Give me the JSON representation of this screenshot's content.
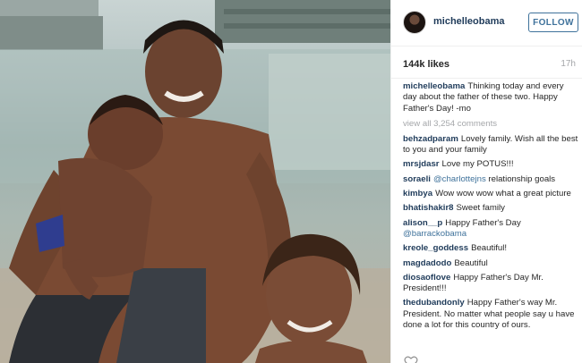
{
  "post": {
    "username": "michelleobama",
    "follow_label": "FOLLOW",
    "likes": "144k likes",
    "time": "17h",
    "caption": {
      "user": "michelleobama",
      "text": "Thinking today and every day about the father of these two. Happy Father's Day! -mo"
    },
    "view_all": "view all 3,254 comments"
  },
  "comments": [
    {
      "user": "behzadparam",
      "text": "Lovely family. Wish all the best to you and your family"
    },
    {
      "user": "mrsjdasr",
      "text": "Love my POTUS!!!"
    },
    {
      "user": "soraeli",
      "mention": "@charlottejns",
      "text": " relationship goals"
    },
    {
      "user": "kimbya",
      "text": "Wow wow wow what a great picture"
    },
    {
      "user": "bhatishakir8",
      "text": "Sweet family"
    },
    {
      "user": "alison__p",
      "text": "Happy Father's Day ",
      "mention": "@barrackobama"
    },
    {
      "user": "kreole_goddess",
      "text": "Beautiful!"
    },
    {
      "user": "magdadodo",
      "text": "Beautiful"
    },
    {
      "user": "diosaoflove",
      "text": "Happy Father's Day Mr. President!!!"
    },
    {
      "user": "thedubandonly",
      "text": "Happy Father's way Mr. President. No matter what people say u have done a lot for this country of ours."
    }
  ],
  "colors": {
    "username": "#1f3b5a",
    "mention": "#3f729b",
    "muted": "#a5a7aa",
    "follow_border": "#3f729b"
  },
  "icons": {
    "footer": "heart-icon"
  }
}
